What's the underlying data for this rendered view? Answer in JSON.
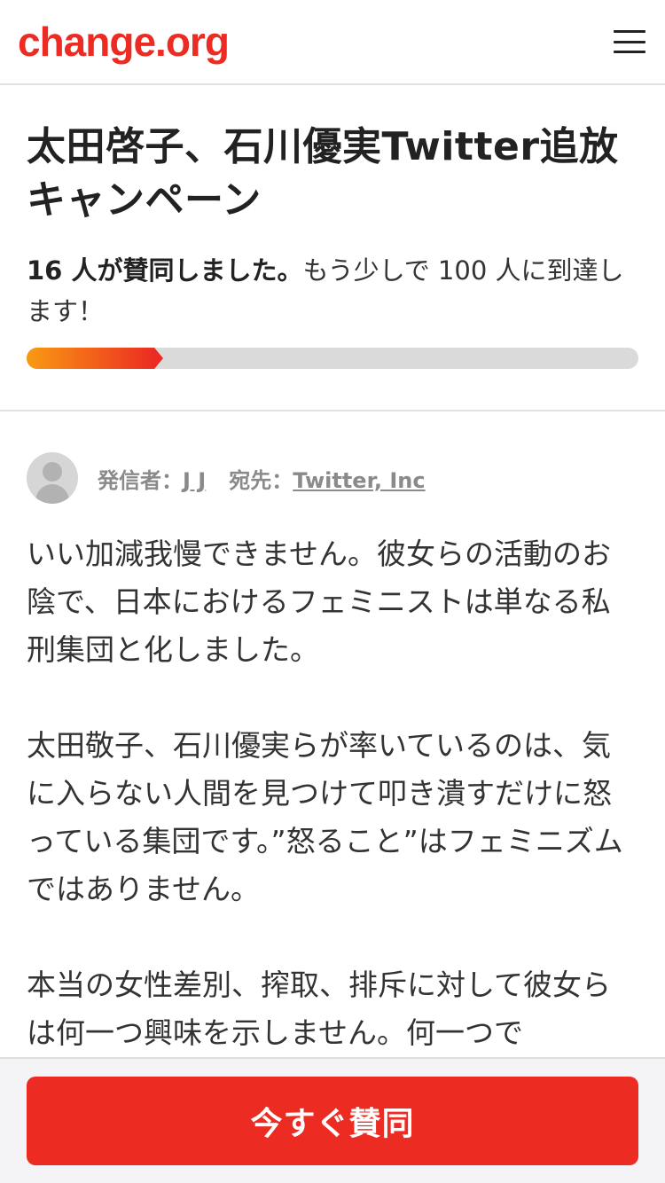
{
  "header": {
    "logo": "change.org",
    "menu_icon": "hamburger-menu-icon"
  },
  "petition": {
    "title": "太田啓子、石川優実Twitter追放キャンペーン",
    "signed_text": "16 人が賛同しました。",
    "goal_text": "もう少しで 100 人に到達します！",
    "signatures": 16,
    "goal": 100,
    "progress_colors": {
      "start": "#f99a12",
      "end": "#ec2c22",
      "track": "#dadada"
    }
  },
  "author": {
    "avatar_icon": "user-avatar-icon",
    "starter_label": "発信者：",
    "starter_name": "J J",
    "target_label": "宛先：",
    "target_name": "Twitter, Inc"
  },
  "body": {
    "paragraphs": [
      "いい加減我慢できません。彼女らの活動のお陰で、日本におけるフェミニストは単なる私刑集団と化しました。",
      "太田敬子、石川優実らが率いているのは、気に入らない人間を見つけて叩き潰すだけに怒っている集団です。”怒ること”はフェミニズムではありません。",
      "本当の女性差別、搾取、排斥に対して彼女らは何一つ興味を示しません。何一つで"
    ]
  },
  "footer": {
    "sign_button": "今すぐ賛同"
  },
  "colors": {
    "brand": "#ec2c22",
    "text": "#333333",
    "muted": "#8a8a8a"
  }
}
